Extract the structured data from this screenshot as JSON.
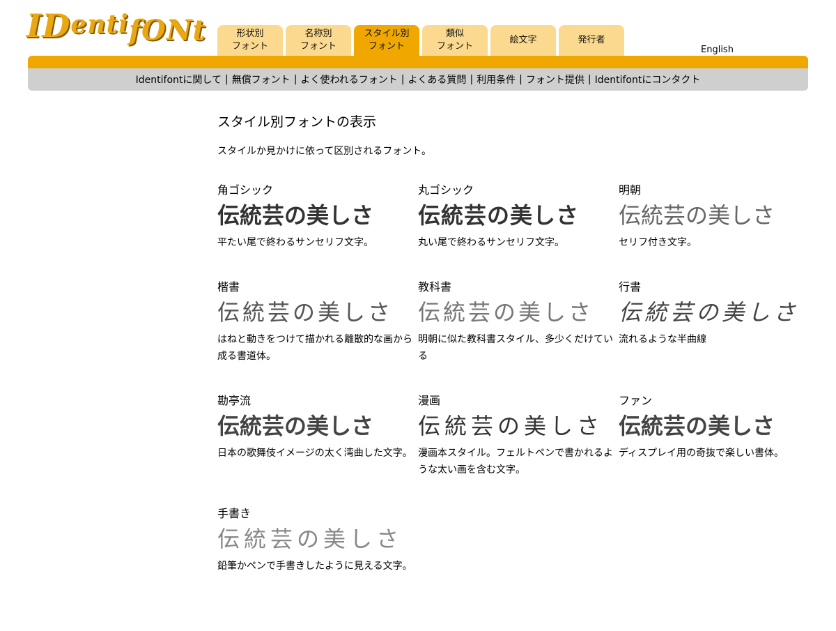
{
  "logo": {
    "part1": "ID",
    "part2": "enti",
    "part3": "fONt"
  },
  "tabs": [
    {
      "label": "形状別\nフォント",
      "active": false
    },
    {
      "label": "名称別\nフォント",
      "active": false
    },
    {
      "label": "スタイル別\nフォント",
      "active": true
    },
    {
      "label": "類似\nフォント",
      "active": false
    },
    {
      "label": "絵文字",
      "active": false
    },
    {
      "label": "発行者",
      "active": false
    }
  ],
  "language_link": "English",
  "nav_links": [
    "Identifontに関して",
    "無償フォント",
    "よく使われるフォント",
    "よくある質問",
    "利用条件",
    "フォント提供",
    "Identifontにコンタクト"
  ],
  "nav_separator": "|",
  "page": {
    "title": "スタイル別フォントの表示",
    "subtitle": "スタイルか見かけに依って区別されるフォント。"
  },
  "styles": [
    {
      "name": "角ゴシック",
      "sample": "伝統芸の美しさ",
      "desc": "平たい尾で終わるサンセリフ文字。"
    },
    {
      "name": "丸ゴシック",
      "sample": "伝統芸の美しさ",
      "desc": "丸い尾で終わるサンセリフ文字。"
    },
    {
      "name": "明朝",
      "sample": "伝統芸の美しさ",
      "desc": "セリフ付き文字。"
    },
    {
      "name": "楷書",
      "sample": "伝統芸の美しさ",
      "desc": "はねと動きをつけて描かれる離散的な画から成る書道体。"
    },
    {
      "name": "教科書",
      "sample": "伝統芸の美しさ",
      "desc": "明朝に似た教科書スタイル、多少くだけている"
    },
    {
      "name": "行書",
      "sample": "伝統芸の美しさ",
      "desc": "流れるような半曲線"
    },
    {
      "name": "勘亭流",
      "sample": "伝統芸の美しさ",
      "desc": "日本の歌舞伎イメージの太く湾曲した文字。"
    },
    {
      "name": "漫画",
      "sample": "伝統芸の美しさ",
      "desc": "漫画本スタイル。フェルトペンで書かれるような太い画を含む文字。"
    },
    {
      "name": "ファン",
      "sample": "伝統芸の美しさ",
      "desc": "ディスプレイ用の奇抜で楽しい書体。"
    },
    {
      "name": "手書き",
      "sample": "伝統芸の美しさ",
      "desc": "鉛筆かペンで手書きしたように見える文字。"
    }
  ],
  "colors": {
    "accent": "#f0a800",
    "tab": "#fbd98e",
    "navbar": "#cfcfcf",
    "logo": "#e9a812"
  }
}
